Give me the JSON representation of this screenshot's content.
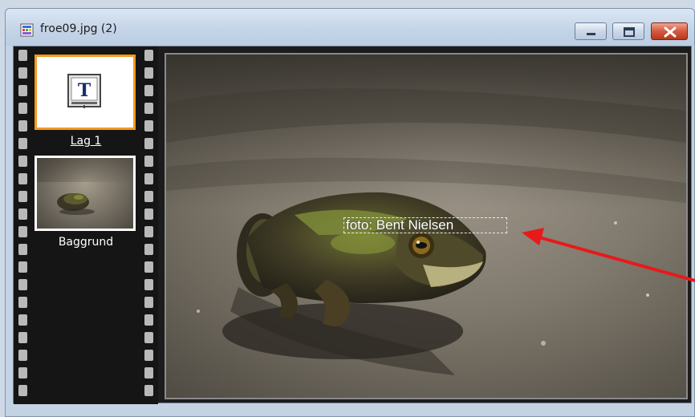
{
  "window": {
    "title": "froe09.jpg (2)",
    "icon": "image-file-icon",
    "controls": [
      "minimize-icon",
      "restore-icon",
      "close-icon"
    ]
  },
  "layers": [
    {
      "label": "Lag 1",
      "type": "text-layer-icon",
      "selected": true
    },
    {
      "label": "Baggrund",
      "type": "photo-thumbnail",
      "selected": false
    }
  ],
  "canvas": {
    "text_object": "foto: Bent Nielsen",
    "image_subject": "frog on stone"
  },
  "colors": {
    "selection": "#f39a1d",
    "annotation_arrow": "#e8191b",
    "filmstrip": "#151515"
  }
}
